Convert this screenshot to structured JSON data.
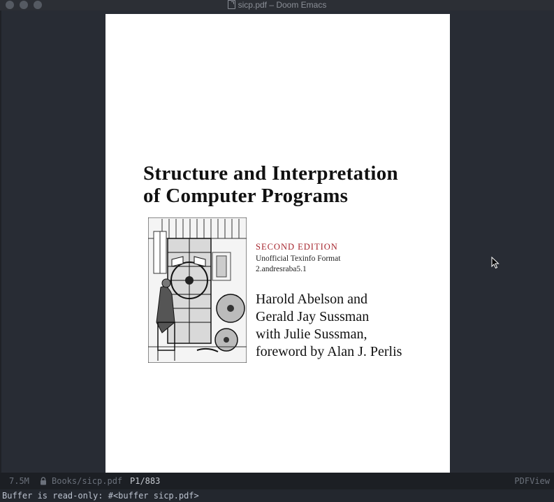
{
  "window": {
    "title": "sicp.pdf – Doom Emacs",
    "file_icon": "pdf-file-icon"
  },
  "pdf_page": {
    "title_line1": "Structure and Interpretation",
    "title_line2": "of Computer Programs",
    "edition": "SECOND EDITION",
    "format_line1": "Unofficial Texinfo Format",
    "format_line2": "2.andresraba5.1",
    "authors": [
      "Harold Abelson and",
      "Gerald Jay Sussman",
      "with Julie Sussman,",
      "foreword by Alan J. Perlis"
    ],
    "illustration": "engraving-of-book-wheel-machine"
  },
  "modeline": {
    "buffer_size": "7.5M",
    "lock_icon": "lock-icon",
    "file_path": "Books/sicp.pdf",
    "page_indicator": "P1/883",
    "major_mode": "PDFView"
  },
  "echo_area": {
    "message": "Buffer is read-only: #<buffer sicp.pdf>"
  },
  "colors": {
    "edition_red": "#a6262e",
    "background": "#282c34",
    "modeline_bg": "#1c1f24"
  }
}
